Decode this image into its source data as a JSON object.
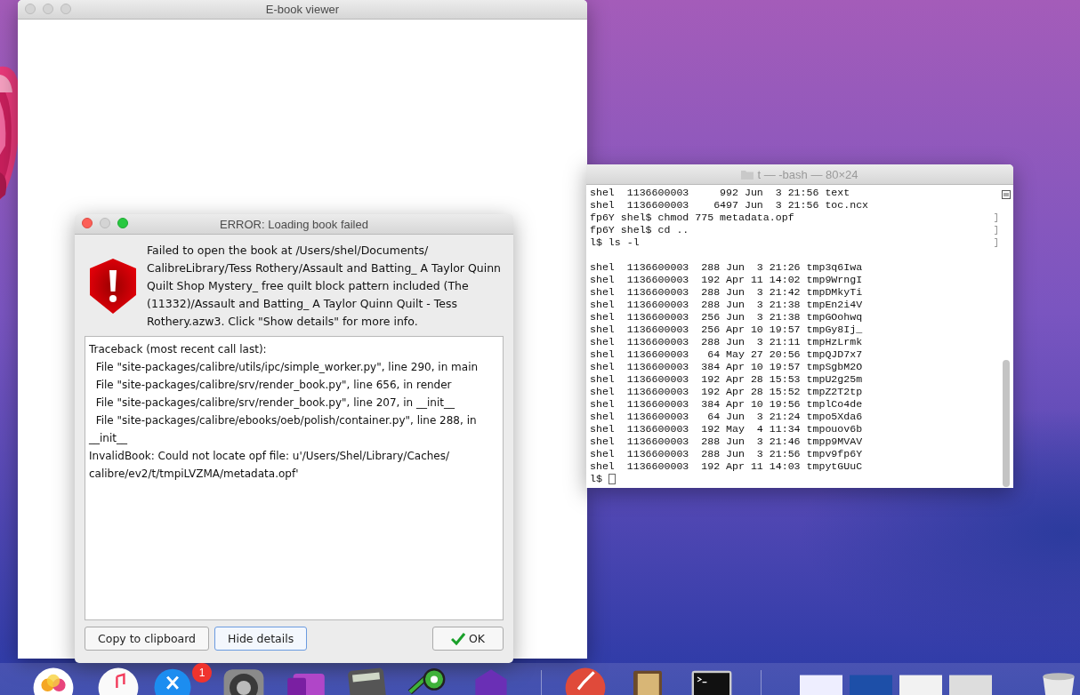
{
  "ebook_window": {
    "title": "E-book viewer",
    "active": false
  },
  "terminal": {
    "title": "t — -bash — 80×24",
    "active": false,
    "lines": [
      {
        "text": "shel  1136600003     992 Jun  3 21:56 text",
        "marked": false
      },
      {
        "text": "shel  1136600003    6497 Jun  3 21:56 toc.ncx",
        "marked": false
      },
      {
        "text": "fp6Y shel$ chmod 775 metadata.opf",
        "marked": true
      },
      {
        "text": "fp6Y shel$ cd ..",
        "marked": true
      },
      {
        "text": "l$ ls -l",
        "marked": true
      },
      {
        "covered": true
      },
      {
        "text": "shel  1136600003  288 Jun  3 21:26 tmp3q6Iwa",
        "marked": false
      },
      {
        "text": "shel  1136600003  192 Apr 11 14:02 tmp9WrngI",
        "marked": false
      },
      {
        "text": "shel  1136600003  288 Jun  3 21:42 tmpDMkyTi",
        "marked": false
      },
      {
        "text": "shel  1136600003  288 Jun  3 21:38 tmpEn2i4V",
        "marked": false
      },
      {
        "text": "shel  1136600003  256 Jun  3 21:38 tmpGOohwq",
        "marked": false
      },
      {
        "text": "shel  1136600003  256 Apr 10 19:57 tmpGy8Ij_",
        "marked": false
      },
      {
        "text": "shel  1136600003  288 Jun  3 21:11 tmpHzLrmk",
        "marked": false
      },
      {
        "text": "shel  1136600003   64 May 27 20:56 tmpQJD7x7",
        "marked": false
      },
      {
        "text": "shel  1136600003  384 Apr 10 19:57 tmpSgbM2O",
        "marked": false
      },
      {
        "text": "shel  1136600003  192 Apr 28 15:53 tmpU2g25m",
        "marked": false
      },
      {
        "text": "shel  1136600003  192 Apr 28 15:52 tmpZ2T2tp",
        "marked": false
      },
      {
        "text": "shel  1136600003  384 Apr 10 19:56 tmplCo4de",
        "marked": false
      },
      {
        "text": "shel  1136600003   64 Jun  3 21:24 tmpo5Xda6",
        "marked": false
      },
      {
        "text": "shel  1136600003  192 May  4 11:34 tmpouov6b",
        "marked": false
      },
      {
        "text": "shel  1136600003  288 Jun  3 21:46 tmpp9MVAV",
        "marked": false
      },
      {
        "text": "shel  1136600003  288 Jun  3 21:56 tmpv9fp6Y",
        "marked": false
      },
      {
        "text": "shel  1136600003  192 Apr 11 14:03 tmpytGUuC",
        "marked": false
      },
      {
        "text": "l$ ",
        "marked": false,
        "cursor": true
      }
    ]
  },
  "dialog": {
    "title": "ERROR: Loading book failed",
    "active": true,
    "message": "Failed to open the book at /Users/shel/Documents/ CalibreLibrary/Tess Rothery/Assault and Batting_ A Taylor Quinn Quilt Shop Mystery_ free quilt block pattern included (The (11332)/Assault and Batting_ A Taylor Quinn Quilt - Tess Rothery.azw3. Click \"Show details\" for more info.",
    "details": [
      "Traceback (most recent call last):",
      "  File \"site-packages/calibre/utils/ipc/simple_worker.py\", line 290, in main",
      "  File \"site-packages/calibre/srv/render_book.py\", line 656, in render",
      "  File \"site-packages/calibre/srv/render_book.py\", line 207, in __init__",
      "  File \"site-packages/calibre/ebooks/oeb/polish/container.py\", line 288, in __init__",
      "InvalidBook: Could not locate opf file: u'/Users/Shel/Library/Caches/ calibre/ev2/t/tmpiLVZMA/metadata.opf'"
    ],
    "buttons": [
      {
        "label": "Copy to clipboard",
        "focused": false,
        "kind": "plain"
      },
      {
        "label": "Hide details",
        "focused": true,
        "kind": "plain"
      },
      {
        "label": "OK",
        "focused": false,
        "kind": "confirm"
      }
    ]
  },
  "dock": {
    "badge": "1"
  }
}
